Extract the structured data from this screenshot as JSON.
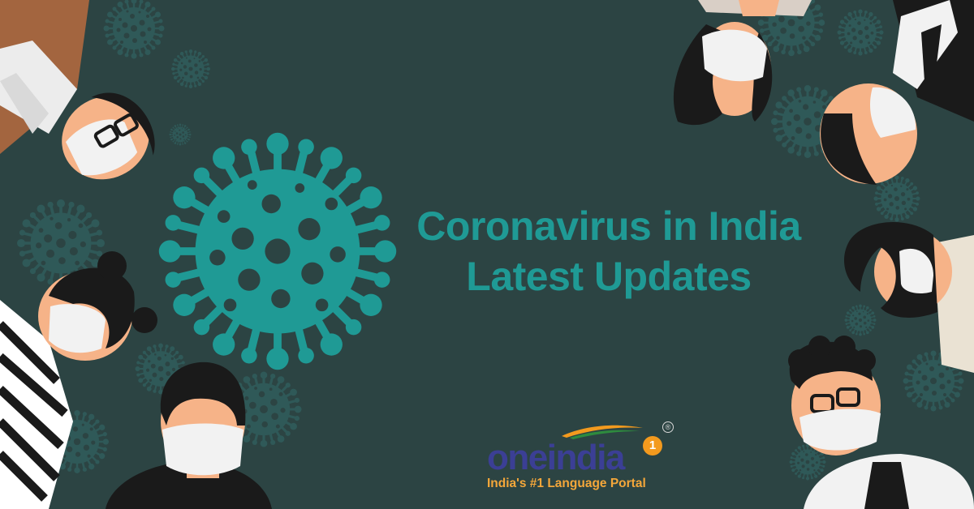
{
  "headline": {
    "line1": "Coronavirus in India",
    "line2": "Latest Updates"
  },
  "logo": {
    "wordmark": "oneindia",
    "badge_number": "1",
    "registered_mark": "®",
    "tagline": "India's #1 Language Portal"
  },
  "colors": {
    "background": "#2c4443",
    "virus_teal": "#1f9a95",
    "virus_dark": "#2f5958",
    "skin": "#f6b388",
    "mask": "#f2f2f2",
    "hair": "#1a1a1a",
    "logo_blue": "#3b3f95",
    "logo_orange": "#f4a73a"
  }
}
